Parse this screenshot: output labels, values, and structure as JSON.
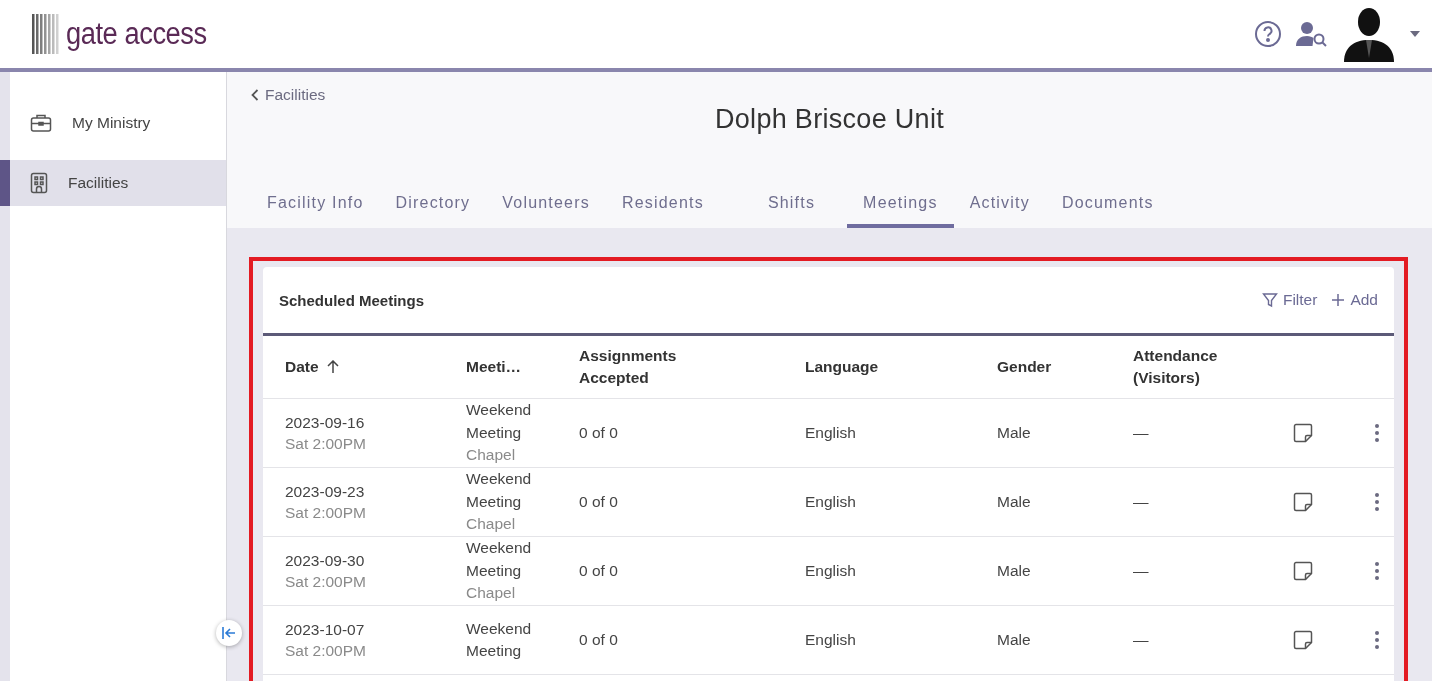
{
  "header": {
    "logo": "gate access"
  },
  "sidebar": {
    "items": [
      {
        "label": "My Ministry",
        "kind": "briefcase",
        "selected": false
      },
      {
        "label": "Facilities",
        "kind": "building",
        "selected": true
      }
    ]
  },
  "breadcrumb": "Facilities",
  "page_title": "Dolph Briscoe Unit",
  "tabs": [
    {
      "label": "Facility Info",
      "selected": false
    },
    {
      "label": "Directory",
      "selected": false
    },
    {
      "label": "Volunteers",
      "selected": false
    },
    {
      "label": "Residents",
      "selected": false
    },
    {
      "label": "Shifts",
      "selected": false
    },
    {
      "label": "Meetings",
      "selected": true
    },
    {
      "label": "Activity",
      "selected": false
    },
    {
      "label": "Documents",
      "selected": false
    }
  ],
  "card": {
    "title": "Scheduled Meetings",
    "actions": [
      {
        "label": "Filter",
        "kind": "filter"
      },
      {
        "label": "Add",
        "kind": "add"
      }
    ]
  },
  "table": {
    "columns": [
      {
        "label": "Date",
        "sorted": true
      },
      {
        "label": "Meeti…"
      },
      {
        "label": "Assignments Accepted"
      },
      {
        "label": "Language"
      },
      {
        "label": "Gender"
      },
      {
        "label": "Attendance (Visitors)"
      }
    ],
    "rows": [
      {
        "date": "2023-09-16",
        "time": "Sat 2:00PM",
        "meeting": "Weekend Meeting",
        "location": "Chapel",
        "assignments": "0 of 0",
        "language": "English",
        "gender": "Male",
        "attendance": "—"
      },
      {
        "date": "2023-09-23",
        "time": "Sat 2:00PM",
        "meeting": "Weekend Meeting",
        "location": "Chapel",
        "assignments": "0 of 0",
        "language": "English",
        "gender": "Male",
        "attendance": "—"
      },
      {
        "date": "2023-09-30",
        "time": "Sat 2:00PM",
        "meeting": "Weekend Meeting",
        "location": "Chapel",
        "assignments": "0 of 0",
        "language": "English",
        "gender": "Male",
        "attendance": "—"
      },
      {
        "date": "2023-10-07",
        "time": "Sat 2:00PM",
        "meeting": "Weekend Meeting",
        "assignments": "0 of 0",
        "language": "English",
        "gender": "Male",
        "attendance": "—"
      }
    ]
  }
}
